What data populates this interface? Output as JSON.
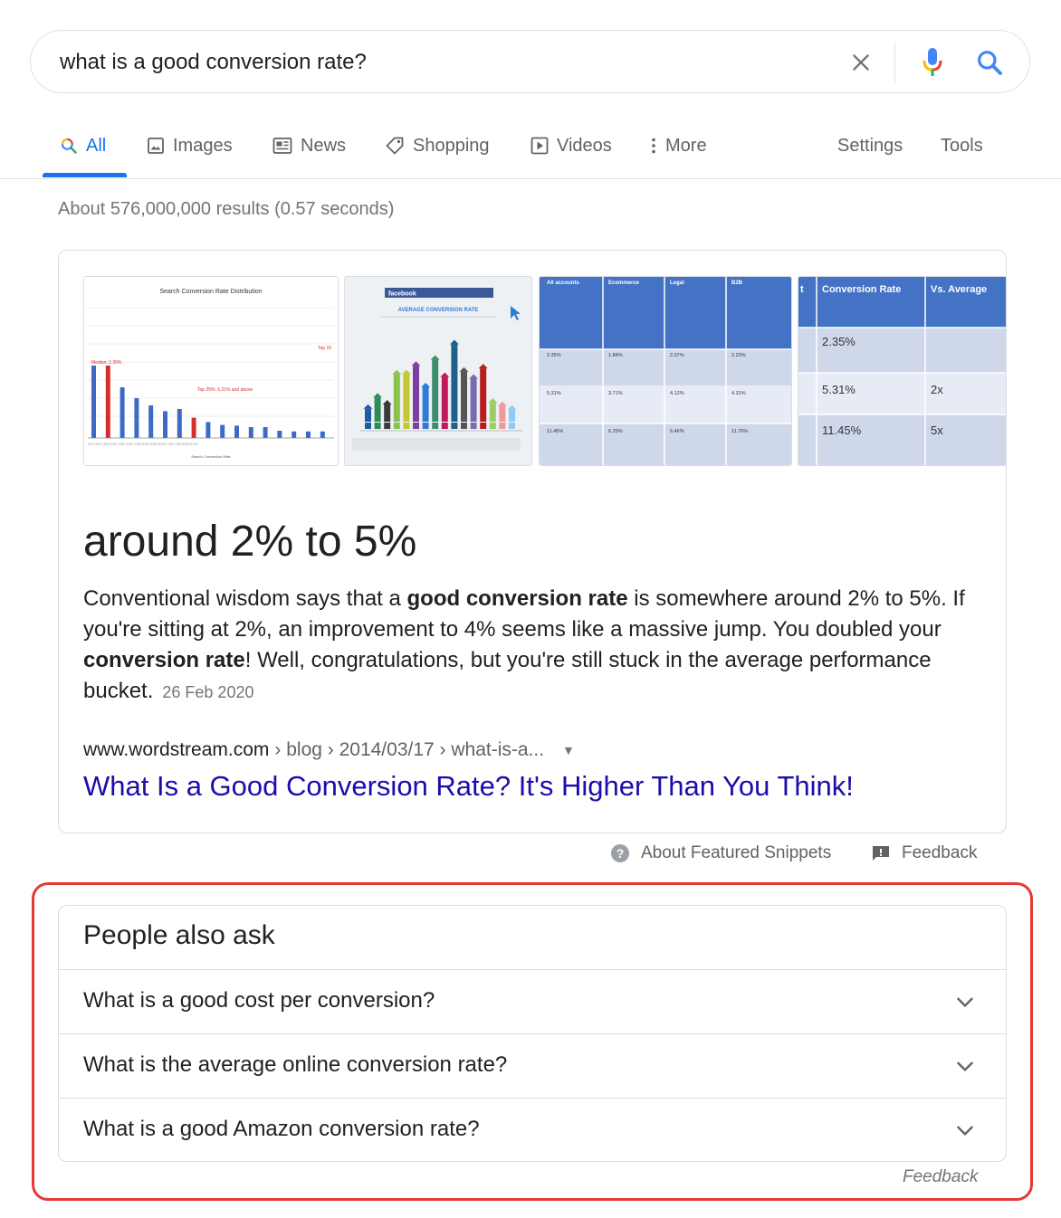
{
  "search": {
    "query": "what is a good conversion rate?",
    "icons": {
      "clear": "close-icon",
      "voice": "microphone-icon",
      "search": "search-icon"
    }
  },
  "tabs": [
    {
      "label": "All",
      "icon": "search-icon",
      "active": true
    },
    {
      "label": "Images",
      "icon": "image-icon"
    },
    {
      "label": "News",
      "icon": "newspaper-icon"
    },
    {
      "label": "Shopping",
      "icon": "tag-icon"
    },
    {
      "label": "Videos",
      "icon": "play-icon"
    },
    {
      "label": "More",
      "icon": "vertical-dots-icon"
    },
    {
      "label": "Settings"
    },
    {
      "label": "Tools"
    }
  ],
  "result_stats": "About 576,000,000 results (0.57 seconds)",
  "featured_snippet": {
    "images": [
      {
        "title": "Search Conversion Rate Distribution",
        "median_label": "Median: 2.35%",
        "top25_label": "Top 25%: 5.31% and above",
        "top10_label": "Top 10",
        "xlabel": "Search Conversion Rate"
      },
      {
        "brand": "facebook",
        "title": "AVERAGE CONVERSION RATE"
      },
      {
        "headers": [
          "All accounts",
          "Ecommerce",
          "Legal",
          "B2B"
        ],
        "rows": [
          [
            "2.35%",
            "1.84%",
            "2.07%",
            "2.23%"
          ],
          [
            "5.31%",
            "3.71%",
            "4.12%",
            "4.31%"
          ],
          [
            "11.45%",
            "6.25%",
            "6.46%",
            "11.70%"
          ]
        ]
      },
      {
        "headers": [
          "t",
          "Conversion Rate",
          "Vs. Average"
        ],
        "rows": [
          [
            "2.35%",
            ""
          ],
          [
            "5.31%",
            "2x"
          ],
          [
            "11.45%",
            "5x"
          ]
        ]
      }
    ],
    "answer": "around 2% to 5%",
    "text": [
      {
        "t": "Conventional wisdom says that a "
      },
      {
        "t": "good conversion rate",
        "b": true
      },
      {
        "t": " is somewhere around 2% to 5%. If you're sitting at 2%, an improvement to 4% seems like a massive jump. You doubled your "
      },
      {
        "t": "conversion rate",
        "b": true
      },
      {
        "t": "! Well, congratulations, but you're still stuck in the average performance bucket."
      }
    ],
    "date": "26 Feb 2020",
    "cite": {
      "domain": "www.wordstream.com",
      "path": "› blog › 2014/03/17 › what-is-a...",
      "arrow": "▼"
    },
    "link_title": "What Is a Good Conversion Rate? It's Higher Than You Think!",
    "footer": {
      "about": "About Featured Snippets",
      "about_icon": "help-circle-icon",
      "feedback": "Feedback",
      "feedback_icon": "feedback-icon"
    }
  },
  "people_also_ask": {
    "title": "People also ask",
    "questions": [
      "What is a good cost per conversion?",
      "What is the average online conversion rate?",
      "What is a good Amazon conversion rate?"
    ],
    "feedback": "Feedback"
  },
  "chart_thumb_1": {
    "bars": [
      {
        "value": 100,
        "color": "#3b6bc4"
      },
      {
        "value": 100,
        "color": "#d32f2f"
      },
      {
        "value": 70,
        "color": "#3b6bc4"
      },
      {
        "value": 55,
        "color": "#3b6bc4"
      },
      {
        "value": 45,
        "color": "#3b6bc4"
      },
      {
        "value": 37,
        "color": "#3b6bc4"
      },
      {
        "value": 40,
        "color": "#3b6bc4"
      },
      {
        "value": 28,
        "color": "#d32f2f"
      },
      {
        "value": 22,
        "color": "#3b6bc4"
      },
      {
        "value": 18,
        "color": "#3b6bc4"
      },
      {
        "value": 17,
        "color": "#3b6bc4"
      },
      {
        "value": 15,
        "color": "#3b6bc4"
      },
      {
        "value": 15,
        "color": "#3b6bc4"
      },
      {
        "value": 10,
        "color": "#3b6bc4"
      },
      {
        "value": 9,
        "color": "#3b6bc4"
      },
      {
        "value": 9,
        "color": "#3b6bc4"
      },
      {
        "value": 9,
        "color": "#3b6bc4"
      }
    ]
  },
  "chart_thumb_2": {
    "bars": [
      {
        "value": 15,
        "color": "#1f5aa8"
      },
      {
        "value": 28,
        "color": "#2e8b57"
      },
      {
        "value": 20,
        "color": "#3a3a3a"
      },
      {
        "value": 55,
        "color": "#8bc34a"
      },
      {
        "value": 55,
        "color": "#c6c635"
      },
      {
        "value": 65,
        "color": "#7b3fa0"
      },
      {
        "value": 40,
        "color": "#2f7bd9"
      },
      {
        "value": 72,
        "color": "#3e8e6e"
      },
      {
        "value": 52,
        "color": "#c2185b"
      },
      {
        "value": 90,
        "color": "#1e5f8c"
      },
      {
        "value": 58,
        "color": "#555555"
      },
      {
        "value": 50,
        "color": "#7b6bb0"
      },
      {
        "value": 62,
        "color": "#b71c1c"
      },
      {
        "value": 22,
        "color": "#9ccc65"
      },
      {
        "value": 18,
        "color": "#ef9a9a"
      },
      {
        "value": 14,
        "color": "#90caf9"
      }
    ]
  }
}
